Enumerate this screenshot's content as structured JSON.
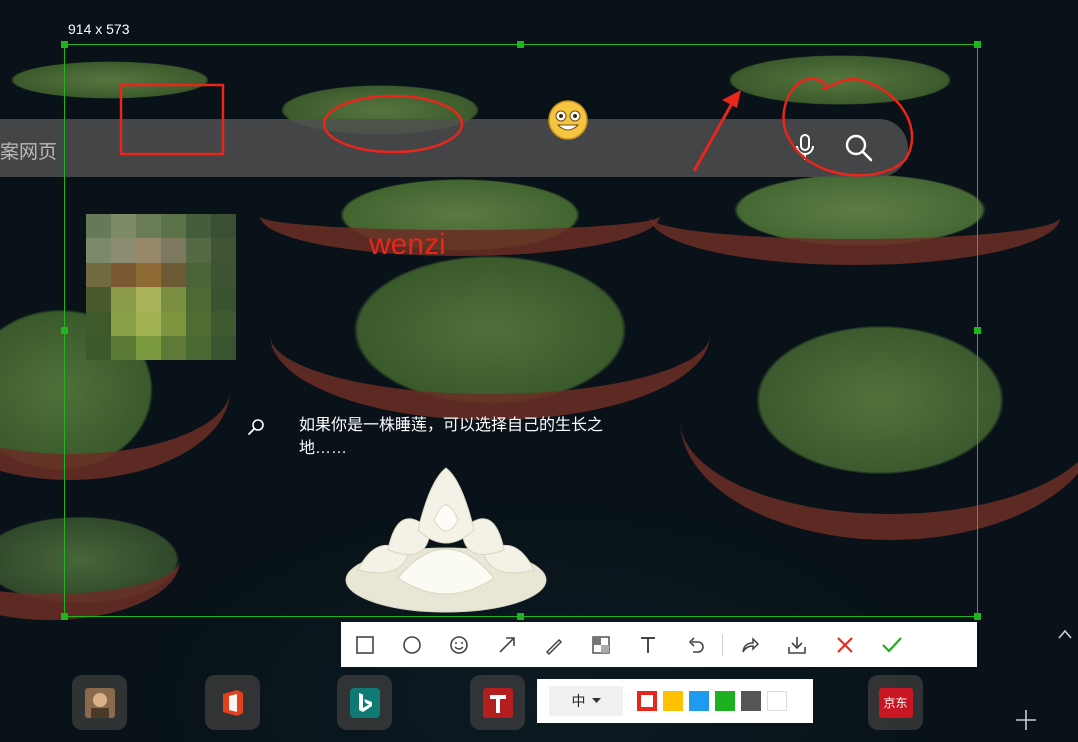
{
  "screen": {
    "selection_size_label": "914 x 573",
    "search_placeholder": "案网页",
    "caption": "如果你是一株睡莲，可以选择自己的生长之地……",
    "annotation_text": "wenzi"
  },
  "toolbar": {
    "tools": [
      "rectangle-tool",
      "ellipse-tool",
      "emoji-tool",
      "arrow-tool",
      "pen-tool",
      "mosaic-tool",
      "text-tool",
      "undo-tool",
      "share-tool",
      "save-tool",
      "cancel-tool",
      "confirm-tool"
    ],
    "active_tool": "text-tool"
  },
  "text_options": {
    "size_label": "中",
    "colors": [
      "#e8261b",
      "#ffc000",
      "#1e9bf0",
      "#1db121",
      "#555555",
      "#ffffff"
    ],
    "selected_color": "#e8261b"
  },
  "annotation_color": "#e8261b",
  "selection_color": "#1fb51f",
  "dock": {
    "tiles": [
      {
        "icon": "avatar-icon"
      },
      {
        "icon": "office-icon"
      },
      {
        "icon": "bing-icon"
      },
      {
        "icon": "t-app-icon"
      },
      {
        "icon": "jd-icon",
        "text": "京东"
      }
    ]
  }
}
